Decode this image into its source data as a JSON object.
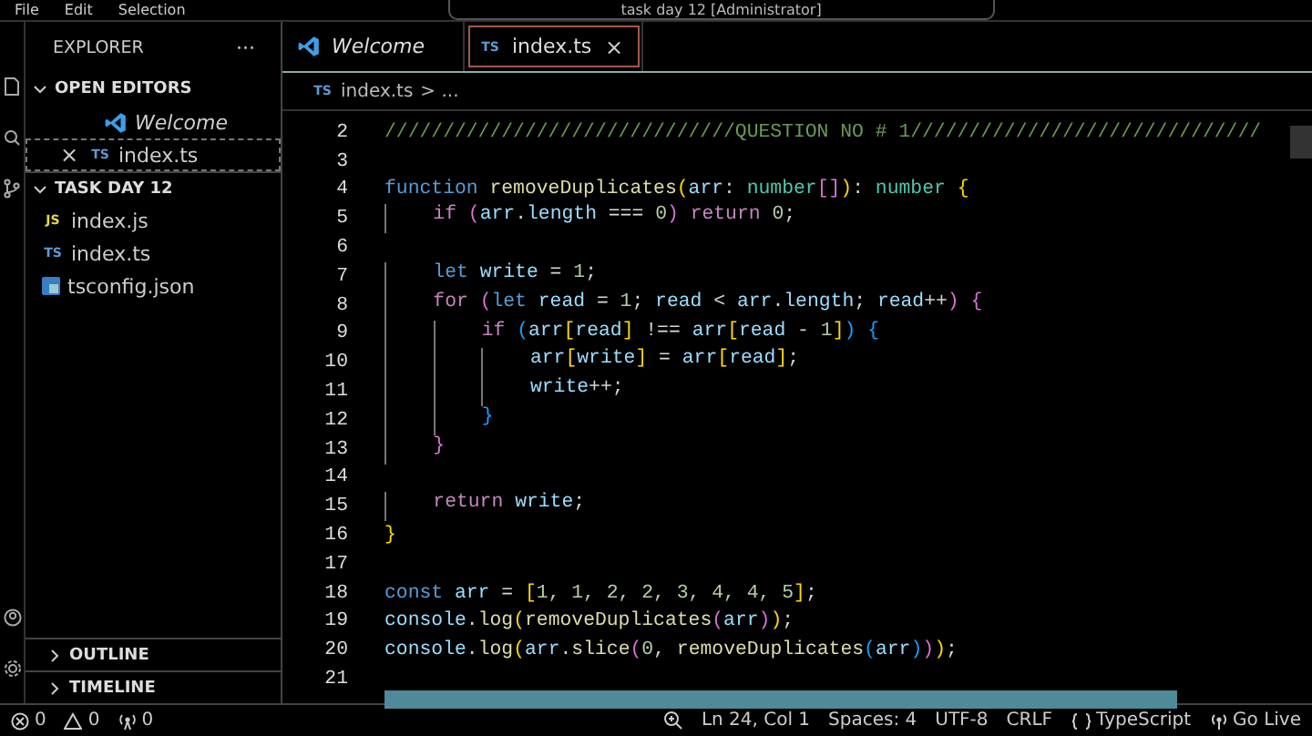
{
  "menu": [
    "File",
    "Edit",
    "Selection"
  ],
  "title": "task day 12 [Administrator]",
  "explorer": {
    "title": "EXPLORER",
    "more": "···",
    "sections": [
      {
        "title": "OPEN EDITORS",
        "expanded": true,
        "items": [
          {
            "label": "Welcome",
            "kind": "vscode",
            "preview": true,
            "focused": false
          },
          {
            "label": "index.ts",
            "kind": "ts",
            "badge": "TS",
            "preview": false,
            "focused": true,
            "close": "×"
          }
        ]
      },
      {
        "title": "TASK DAY 12",
        "expanded": true,
        "items": [
          {
            "label": "index.js",
            "kind": "js",
            "badge": "JS",
            "preview": false,
            "focused": false
          },
          {
            "label": "index.ts",
            "kind": "ts",
            "badge": "TS",
            "preview": false,
            "focused": false
          },
          {
            "label": "tsconfig.json",
            "kind": "tsconfig",
            "preview": false,
            "focused": false
          }
        ]
      }
    ],
    "panels": [
      {
        "title": "OUTLINE",
        "expanded": false
      },
      {
        "title": "TIMELINE",
        "expanded": false
      }
    ]
  },
  "tabs": [
    {
      "label": "Welcome",
      "kind": "vscode",
      "preview": true,
      "selected": false
    },
    {
      "label": "index.ts",
      "kind": "ts",
      "badge": "TS",
      "preview": false,
      "selected": true,
      "close": "×"
    }
  ],
  "breadcrumb": {
    "file": "index.ts",
    "kind": "ts",
    "badge": "TS",
    "rest": "> ..."
  },
  "code": [
    {
      "number": "2",
      "tokens": [
        {
          "kind": "comment",
          "text": "//////////////////////////////QUESTION NO # 1//////////////////////////////"
        }
      ]
    },
    {
      "number": "3"
    },
    {
      "number": "4",
      "tokens": [
        {
          "kind": "kw",
          "text": "function "
        },
        {
          "kind": "fn",
          "text": "removeDuplicates"
        },
        {
          "kind": "b1",
          "text": "("
        },
        {
          "kind": "var",
          "text": "arr"
        },
        {
          "kind": "plain",
          "text": ": "
        },
        {
          "kind": "type",
          "text": "number"
        },
        {
          "kind": "b2",
          "text": "[]"
        },
        {
          "kind": "b1",
          "text": ")"
        },
        {
          "kind": "plain",
          "text": ": "
        },
        {
          "kind": "type",
          "text": "number "
        },
        {
          "kind": "b1",
          "text": "{"
        }
      ]
    },
    {
      "number": "5",
      "tokens": [
        {
          "kind": "ctl",
          "text": "    if "
        },
        {
          "kind": "b2",
          "text": "("
        },
        {
          "kind": "var",
          "text": "arr"
        },
        {
          "kind": "plain",
          "text": "."
        },
        {
          "kind": "var",
          "text": "length"
        },
        {
          "kind": "plain",
          "text": " === "
        },
        {
          "kind": "num",
          "text": "0"
        },
        {
          "kind": "b2",
          "text": ")"
        },
        {
          "kind": "ctl",
          "text": " return "
        },
        {
          "kind": "num",
          "text": "0"
        },
        {
          "kind": "plain",
          "text": ";"
        }
      ]
    },
    {
      "number": "6"
    },
    {
      "number": "7",
      "tokens": [
        {
          "kind": "kw",
          "text": "    let "
        },
        {
          "kind": "var",
          "text": "write"
        },
        {
          "kind": "plain",
          "text": " = "
        },
        {
          "kind": "num",
          "text": "1"
        },
        {
          "kind": "plain",
          "text": ";"
        }
      ]
    },
    {
      "number": "8",
      "tokens": [
        {
          "kind": "ctl",
          "text": "    for "
        },
        {
          "kind": "b2",
          "text": "("
        },
        {
          "kind": "kw",
          "text": "let "
        },
        {
          "kind": "var",
          "text": "read"
        },
        {
          "kind": "plain",
          "text": " = "
        },
        {
          "kind": "num",
          "text": "1"
        },
        {
          "kind": "plain",
          "text": "; "
        },
        {
          "kind": "var",
          "text": "read"
        },
        {
          "kind": "plain",
          "text": " < "
        },
        {
          "kind": "var",
          "text": "arr"
        },
        {
          "kind": "plain",
          "text": "."
        },
        {
          "kind": "var",
          "text": "length"
        },
        {
          "kind": "plain",
          "text": "; "
        },
        {
          "kind": "var",
          "text": "read"
        },
        {
          "kind": "plain",
          "text": "++"
        },
        {
          "kind": "b2",
          "text": ")"
        },
        {
          "kind": "b2",
          "text": " {"
        }
      ]
    },
    {
      "number": "9",
      "tokens": [
        {
          "kind": "ctl",
          "text": "        if "
        },
        {
          "kind": "b3",
          "text": "("
        },
        {
          "kind": "var",
          "text": "arr"
        },
        {
          "kind": "b1",
          "text": "["
        },
        {
          "kind": "var",
          "text": "read"
        },
        {
          "kind": "b1",
          "text": "]"
        },
        {
          "kind": "plain",
          "text": " !== "
        },
        {
          "kind": "var",
          "text": "arr"
        },
        {
          "kind": "b1",
          "text": "["
        },
        {
          "kind": "var",
          "text": "read"
        },
        {
          "kind": "plain",
          "text": " - "
        },
        {
          "kind": "num",
          "text": "1"
        },
        {
          "kind": "b1",
          "text": "]"
        },
        {
          "kind": "b3",
          "text": ")"
        },
        {
          "kind": "b3",
          "text": " {"
        }
      ]
    },
    {
      "number": "10",
      "tokens": [
        {
          "kind": "var",
          "text": "            arr"
        },
        {
          "kind": "b1",
          "text": "["
        },
        {
          "kind": "var",
          "text": "write"
        },
        {
          "kind": "b1",
          "text": "]"
        },
        {
          "kind": "plain",
          "text": " = "
        },
        {
          "kind": "var",
          "text": "arr"
        },
        {
          "kind": "b1",
          "text": "["
        },
        {
          "kind": "var",
          "text": "read"
        },
        {
          "kind": "b1",
          "text": "]"
        },
        {
          "kind": "plain",
          "text": ";"
        }
      ]
    },
    {
      "number": "11",
      "tokens": [
        {
          "kind": "var",
          "text": "            write"
        },
        {
          "kind": "plain",
          "text": "++;"
        }
      ]
    },
    {
      "number": "12",
      "tokens": [
        {
          "kind": "b3",
          "text": "        }"
        }
      ]
    },
    {
      "number": "13",
      "tokens": [
        {
          "kind": "b2",
          "text": "    }"
        }
      ]
    },
    {
      "number": "14"
    },
    {
      "number": "15",
      "tokens": [
        {
          "kind": "ctl",
          "text": "    return "
        },
        {
          "kind": "var",
          "text": "write"
        },
        {
          "kind": "plain",
          "text": ";"
        }
      ]
    },
    {
      "number": "16",
      "tokens": [
        {
          "kind": "b1",
          "text": "}"
        }
      ]
    },
    {
      "number": "17"
    },
    {
      "number": "18",
      "tokens": [
        {
          "kind": "kw",
          "text": "const "
        },
        {
          "kind": "var",
          "text": "arr"
        },
        {
          "kind": "plain",
          "text": " = "
        },
        {
          "kind": "b1",
          "text": "["
        },
        {
          "kind": "num",
          "text": "1, 1, 2, 2, 3, 4, 4, 5"
        },
        {
          "kind": "b1",
          "text": "]"
        },
        {
          "kind": "plain",
          "text": ";"
        }
      ]
    },
    {
      "number": "19",
      "tokens": [
        {
          "kind": "var",
          "text": "console"
        },
        {
          "kind": "plain",
          "text": "."
        },
        {
          "kind": "fn",
          "text": "log"
        },
        {
          "kind": "b1",
          "text": "("
        },
        {
          "kind": "fn",
          "text": "removeDuplicates"
        },
        {
          "kind": "b2",
          "text": "("
        },
        {
          "kind": "var",
          "text": "arr"
        },
        {
          "kind": "b2",
          "text": ")"
        },
        {
          "kind": "b1",
          "text": ")"
        },
        {
          "kind": "plain",
          "text": ";"
        }
      ]
    },
    {
      "number": "20",
      "tokens": [
        {
          "kind": "var",
          "text": "console"
        },
        {
          "kind": "plain",
          "text": "."
        },
        {
          "kind": "fn",
          "text": "log"
        },
        {
          "kind": "b1",
          "text": "("
        },
        {
          "kind": "var",
          "text": "arr"
        },
        {
          "kind": "plain",
          "text": "."
        },
        {
          "kind": "fn",
          "text": "slice"
        },
        {
          "kind": "b2",
          "text": "("
        },
        {
          "kind": "num",
          "text": "0"
        },
        {
          "kind": "plain",
          "text": ", "
        },
        {
          "kind": "fn",
          "text": "removeDuplicates"
        },
        {
          "kind": "b3",
          "text": "("
        },
        {
          "kind": "var",
          "text": "arr"
        },
        {
          "kind": "b3",
          "text": ")"
        },
        {
          "kind": "b2",
          "text": ")"
        },
        {
          "kind": "b1",
          "text": ")"
        },
        {
          "kind": "plain",
          "text": ";"
        }
      ]
    },
    {
      "number": "21"
    }
  ],
  "status": {
    "left": [
      {
        "kind": "errors",
        "text": "0"
      },
      {
        "kind": "warnings",
        "text": "0"
      },
      {
        "kind": "ports",
        "text": "0"
      }
    ],
    "right": [
      {
        "kind": "zoom"
      },
      {
        "kind": "plain",
        "text": "Ln 24, Col 1"
      },
      {
        "kind": "plain",
        "text": "Spaces: 4"
      },
      {
        "kind": "plain",
        "text": "UTF-8"
      },
      {
        "kind": "plain",
        "text": "CRLF"
      },
      {
        "kind": "language",
        "text": "TypeScript"
      },
      {
        "kind": "live",
        "text": "Go Live"
      }
    ]
  }
}
